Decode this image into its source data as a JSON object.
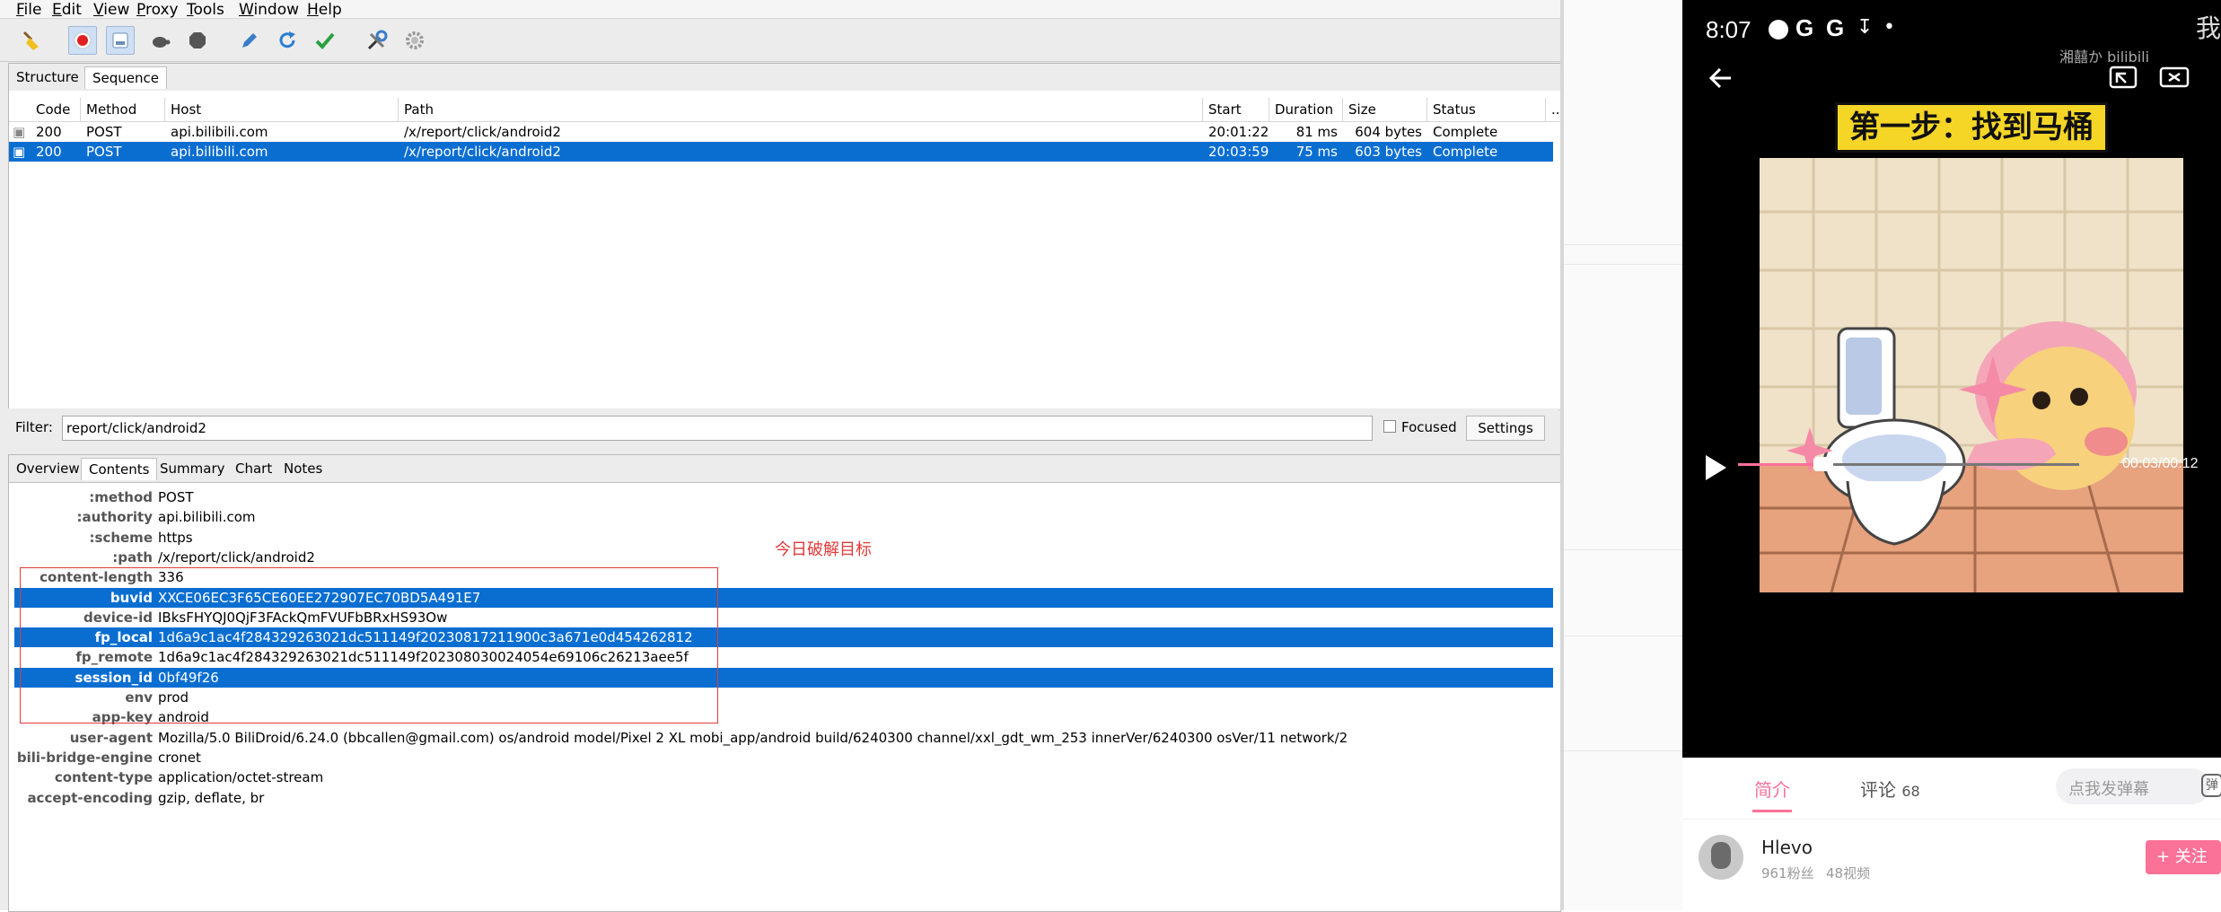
{
  "menu": [
    "File",
    "Edit",
    "View",
    "Proxy",
    "Tools",
    "Window",
    "Help"
  ],
  "menu_underline": [
    "F",
    "E",
    "V",
    "P",
    "T",
    "W",
    "H"
  ],
  "toolbar": {
    "icons": [
      "broom-icon",
      "record-icon",
      "throttle-icon",
      "turtle-icon",
      "stop-icon",
      "pen-icon",
      "refresh-icon",
      "check-icon",
      "tools-icon",
      "gear-icon"
    ]
  },
  "top_tabs": [
    "Structure",
    "Sequence"
  ],
  "columns": [
    "Code",
    "Method",
    "Host",
    "Path",
    "Start",
    "Duration",
    "Size",
    "Status",
    "..."
  ],
  "requests": [
    {
      "code": "200",
      "method": "POST",
      "host": "api.bilibili.com",
      "path": "/x/report/click/android2",
      "start": "20:01:22",
      "duration": "81 ms",
      "size": "604 bytes",
      "status": "Complete",
      "selected": false
    },
    {
      "code": "200",
      "method": "POST",
      "host": "api.bilibili.com",
      "path": "/x/report/click/android2",
      "start": "20:03:59",
      "duration": "75 ms",
      "size": "603 bytes",
      "status": "Complete",
      "selected": true
    }
  ],
  "filter": {
    "label": "Filter:",
    "value": "report/click/android2",
    "focused_label": "Focused",
    "settings_label": "Settings"
  },
  "bottom_tabs": [
    "Overview",
    "Contents",
    "Summary",
    "Chart",
    "Notes"
  ],
  "headers": [
    {
      "k": ":method",
      "v": "POST",
      "sel": false
    },
    {
      "k": ":authority",
      "v": "api.bilibili.com",
      "sel": false
    },
    {
      "k": ":scheme",
      "v": "https",
      "sel": false
    },
    {
      "k": ":path",
      "v": "/x/report/click/android2",
      "sel": false
    },
    {
      "k": "content-length",
      "v": "336",
      "sel": false
    },
    {
      "k": "buvid",
      "v": "XXCE06EC3F65CE60EE272907EC70BD5A491E7",
      "sel": true
    },
    {
      "k": "device-id",
      "v": "IBksFHYQJ0QjF3FAckQmFVUFbBRxHS93Ow",
      "sel": false
    },
    {
      "k": "fp_local",
      "v": "1d6a9c1ac4f284329263021dc511149f20230817211900c3a671e0d454262812",
      "sel": true
    },
    {
      "k": "fp_remote",
      "v": "1d6a9c1ac4f284329263021dc511149f202308030024054e69106c26213aee5f",
      "sel": false
    },
    {
      "k": "session_id",
      "v": "0bf49f26",
      "sel": true
    },
    {
      "k": "env",
      "v": "prod",
      "sel": false
    },
    {
      "k": "app-key",
      "v": "android",
      "sel": false
    },
    {
      "k": "user-agent",
      "v": "Mozilla/5.0 BiliDroid/6.24.0 (bbcallen@gmail.com) os/android model/Pixel 2 XL mobi_app/android build/6240300 channel/xxl_gdt_wm_253 innerVer/6240300 osVer/11 network/2",
      "sel": false
    },
    {
      "k": "bili-bridge-engine",
      "v": "cronet",
      "sel": false
    },
    {
      "k": "content-type",
      "v": "application/octet-stream",
      "sel": false
    },
    {
      "k": "accept-encoding",
      "v": "gzip, deflate, br",
      "sel": false
    }
  ],
  "annotation": "今日破解目标",
  "phone": {
    "time": "8:07",
    "corner_text": "我",
    "watermark": "湘囍か bilibili",
    "caption": "第一步：找到马桶",
    "elapsed": "00:03/00:12",
    "tabs": [
      {
        "label": "简介",
        "active": true
      },
      {
        "label": "评论",
        "count": "68",
        "active": false
      }
    ],
    "danmaku_placeholder": "点我发弹幕",
    "danmaku_icon_text": "弹",
    "uploader": {
      "name": "Hlevo",
      "fans": "961粉丝",
      "videos": "48视频"
    },
    "follow_label": "+ 关注",
    "progress": 0.25
  },
  "colors": {
    "accent": "#0a6ed1",
    "annotation": "#e03a3a",
    "bili_pink": "#fb7299",
    "caption_bg": "#f5d626"
  }
}
